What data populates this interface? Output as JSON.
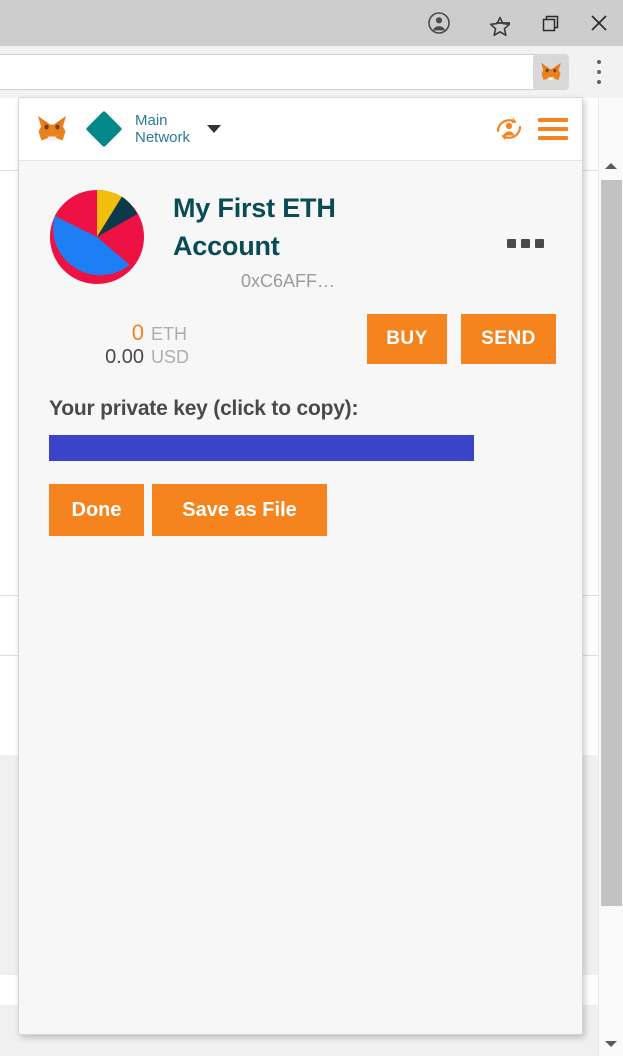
{
  "browser": {
    "window_controls": [
      {
        "name": "profile-avatar",
        "icon": "person-icon",
        "label": ""
      },
      {
        "name": "minimize",
        "icon": "minimize-icon",
        "label": ""
      },
      {
        "name": "restore",
        "icon": "restore-icon",
        "label": ""
      },
      {
        "name": "close",
        "icon": "close-icon",
        "label": ""
      }
    ],
    "toolbar": {
      "omnibox_value": "",
      "omnibox_placeholder": "",
      "bookmark_icon": "star-icon",
      "extension_icon": "metamask-fox-icon",
      "menu_icon": "chrome-menu-icon"
    }
  },
  "metamask": {
    "header": {
      "logo_icon": "metamask-fox-icon",
      "network_icon": "diamond-icon",
      "network_name": "Main Network",
      "network_caret_icon": "chevron-down-icon",
      "account_switch_icon": "account-switch-icon",
      "menu_icon": "hamburger-menu-icon"
    },
    "account": {
      "identicon": "pie-identicon",
      "name": "My First ETH Account",
      "address": "0xC6AFF…",
      "options_icon": "more-options-icon"
    },
    "balance": {
      "eth_amount": "0",
      "eth_unit": "ETH",
      "usd_amount": "0.00",
      "usd_unit": "USD"
    },
    "actions": {
      "buy_label": "BUY",
      "send_label": "SEND"
    },
    "private_key": {
      "label": "Your private key (click to copy):",
      "value": "",
      "done_label": "Done",
      "save_label": "Save as File"
    }
  },
  "colors": {
    "accent_orange": "#f5841f",
    "teal": "#038789",
    "network_text": "#2b7a9e",
    "account_name": "#0a4b55",
    "private_key_block": "#3b44c8",
    "identicon_red": "#ee1144",
    "identicon_blue": "#1e7ef5",
    "identicon_yellow": "#f0be0c",
    "identicon_dark": "#0c3a4a"
  }
}
